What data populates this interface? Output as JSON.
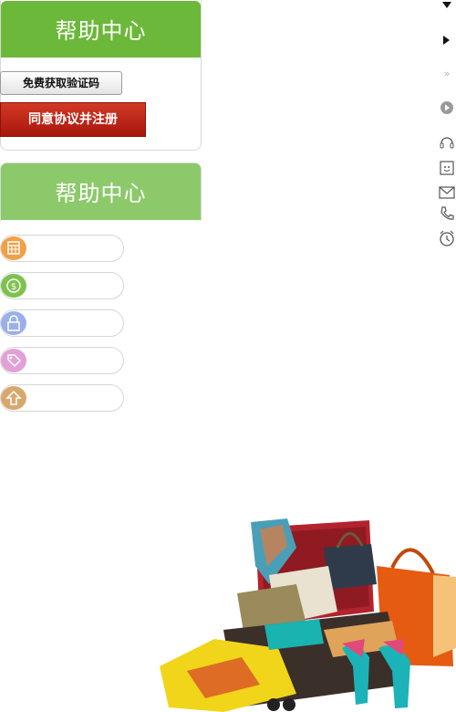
{
  "help_center_title_1": "帮助中心",
  "help_center_title_2": "帮助中心",
  "buttons": {
    "get_code": "免费获取验证码",
    "agree_register": "同意协议并注册"
  },
  "menu_icons": [
    {
      "name": "calendar-icon",
      "color": "#f0a048"
    },
    {
      "name": "coin-icon",
      "color": "#7dc24e"
    },
    {
      "name": "lock-icon",
      "color": "#9ab0e8"
    },
    {
      "name": "tag-icon",
      "color": "#e2a0d6"
    },
    {
      "name": "upload-icon",
      "color": "#d7a86e"
    }
  ],
  "side_tools": [
    "triangle-down-icon",
    "triangle-right-icon",
    "double-chevron-icon",
    "play-icon",
    "headset-icon",
    "wechat-icon",
    "mail-icon",
    "phone-icon",
    "alarm-icon"
  ],
  "colors": {
    "green": "#6cb83a",
    "green_light": "#8cc96a",
    "red": "#b81c10"
  }
}
